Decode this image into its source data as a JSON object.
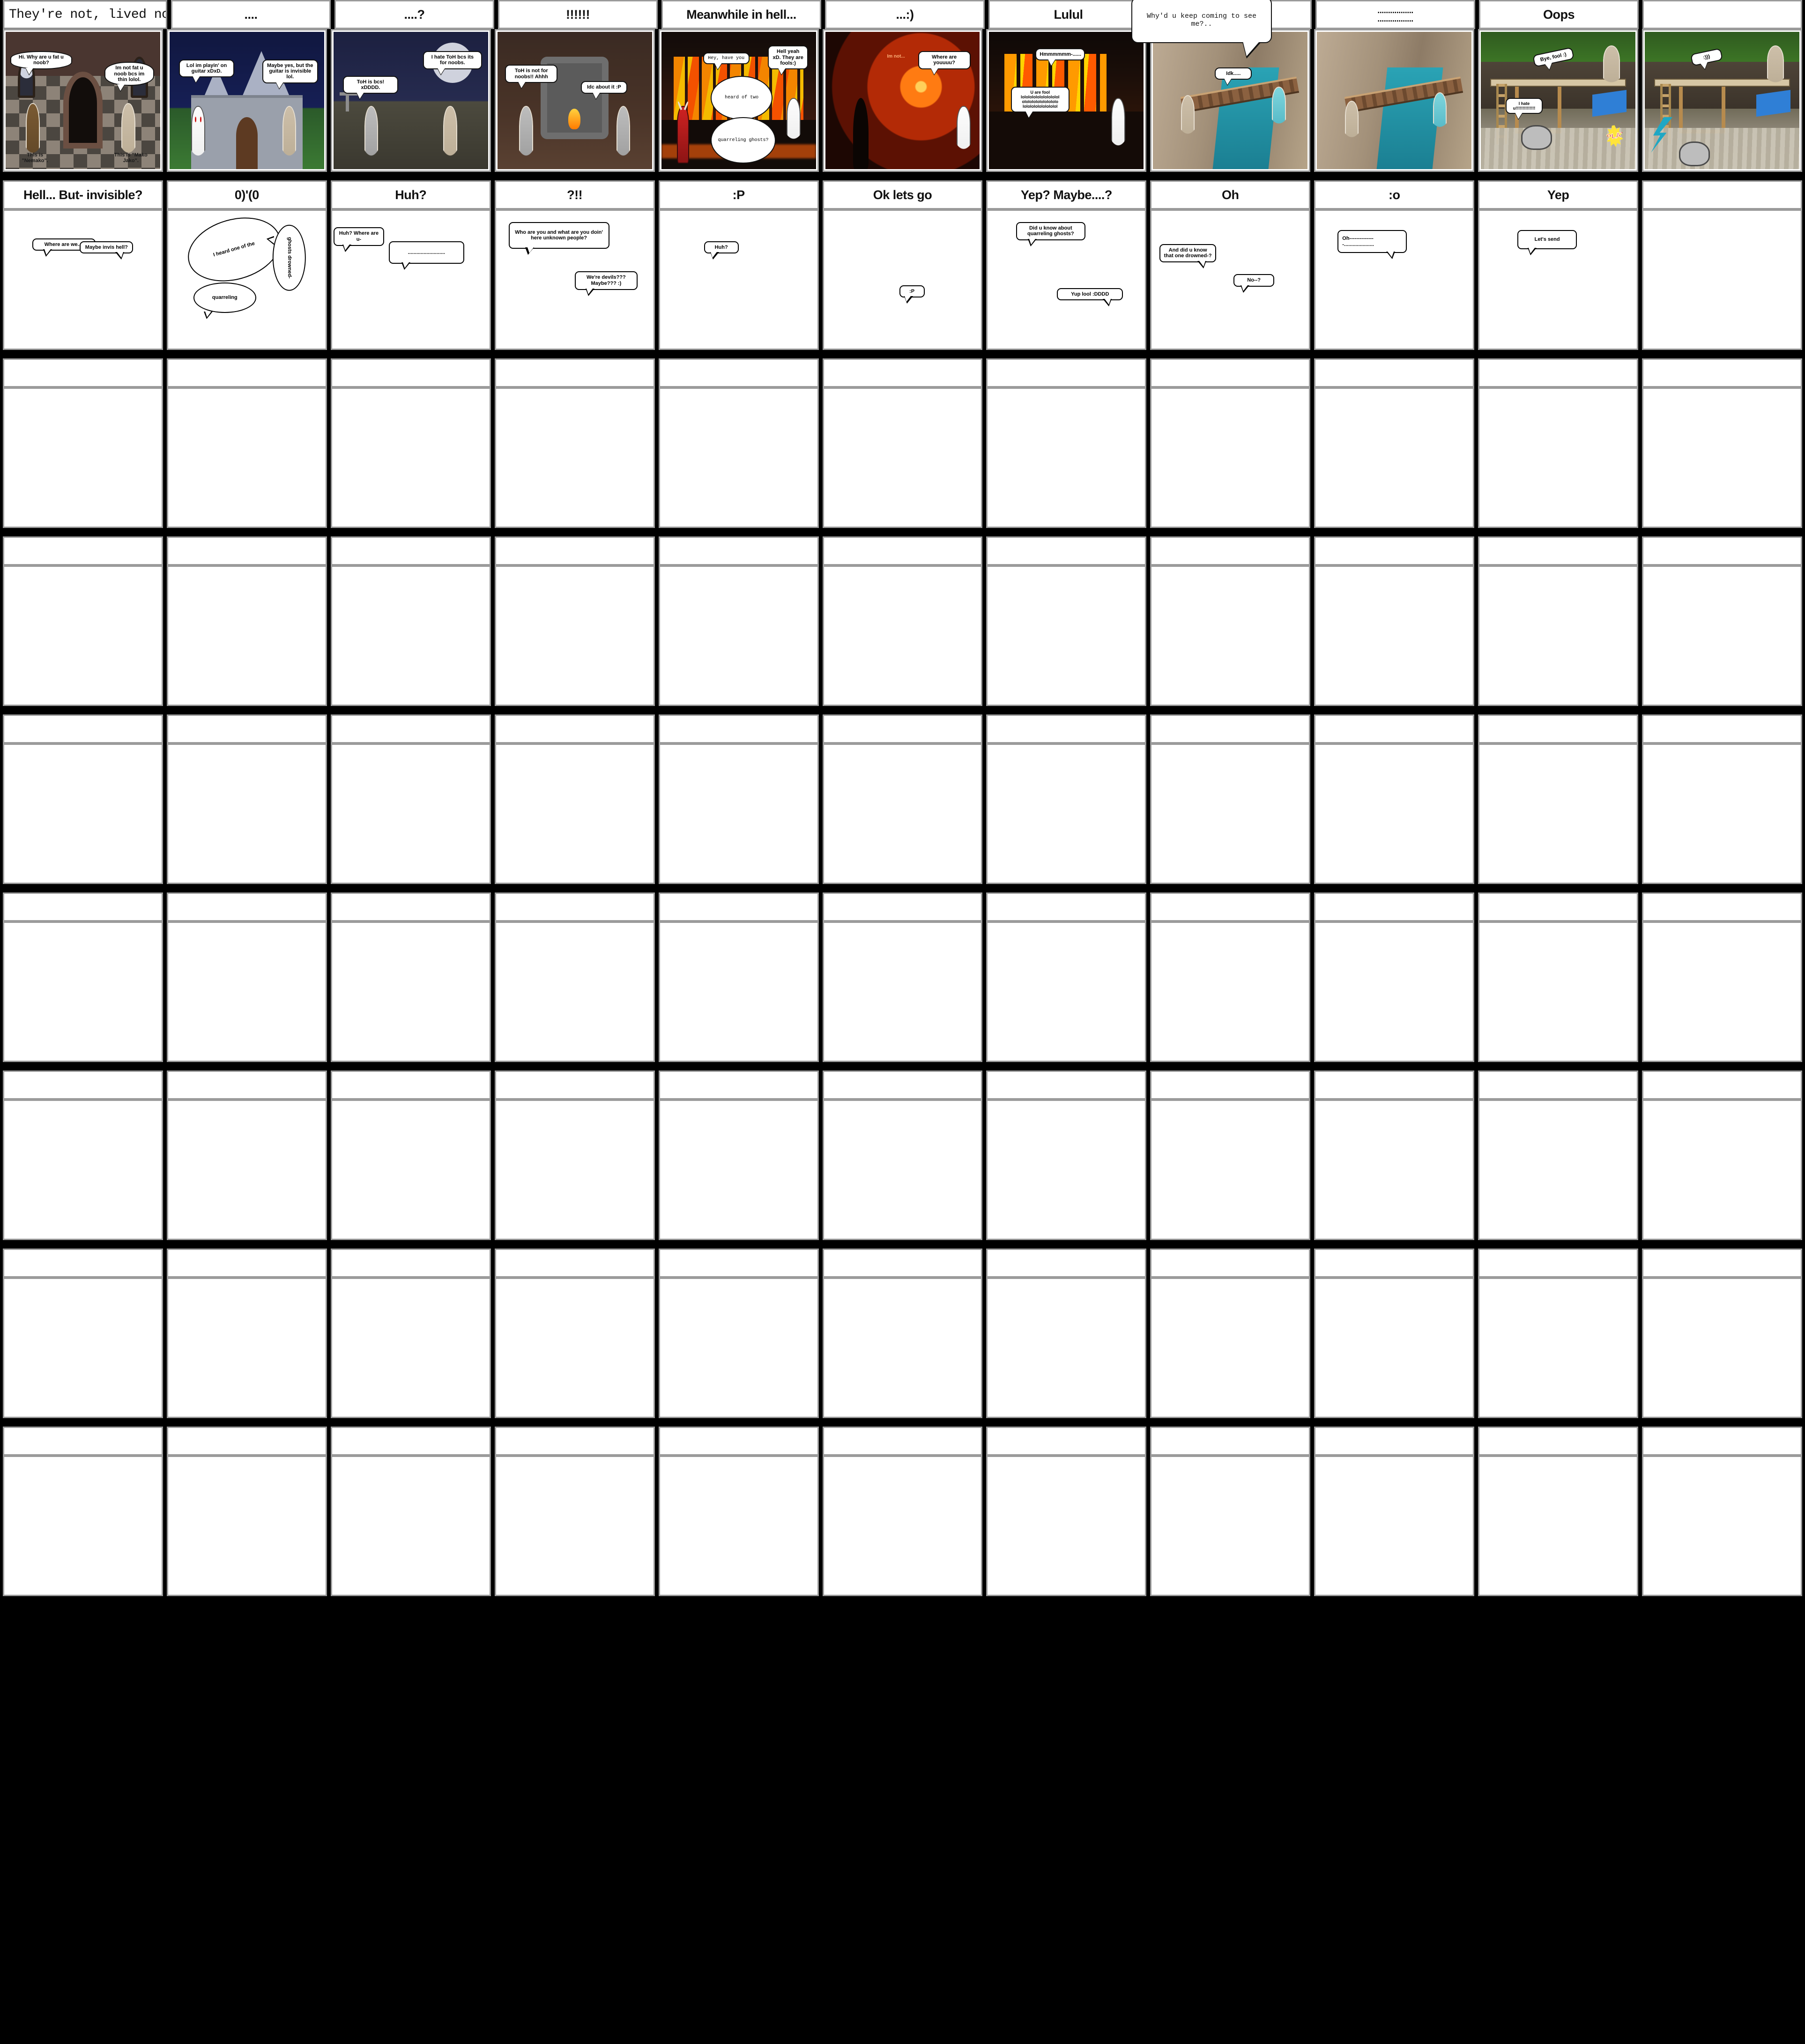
{
  "app": {
    "name": "storyboard-grid-editor",
    "columns": 11,
    "rows": 9,
    "background_color": "#000000",
    "cell_border_color": "#9b9b9b"
  },
  "overlay_textbox": {
    "text": "Why'd u keep coming to see me?..",
    "editable": true
  },
  "row1": {
    "titles": [
      {
        "text": "They're not, lived not li",
        "style": "input",
        "truncated": true
      },
      {
        "text": "....",
        "style": "title"
      },
      {
        "text": "....?",
        "style": "title"
      },
      {
        "text": "!!!!!!",
        "style": "title"
      },
      {
        "text": "Meanwhile in hell...",
        "style": "title"
      },
      {
        "text": "...:)",
        "style": "title"
      },
      {
        "text": "Lulul",
        "style": "title"
      },
      {
        "text": "",
        "style": "title"
      },
      {
        "text": ".................\n.................",
        "style": "title"
      },
      {
        "text": "Oops",
        "style": "title"
      },
      {
        "text": "",
        "style": "title"
      }
    ],
    "panels": [
      {
        "scene": "church-interior",
        "bubbles": [
          {
            "text": "Hi. Why are u fat u noob?",
            "shape": "cloud"
          },
          {
            "text": "Im not fat u noob bcs im thin lolol.",
            "shape": "cloud"
          },
          {
            "text": "This is \"Nemako\".",
            "shape": "caption"
          },
          {
            "text": "This is \"Mako Jako\".",
            "shape": "caption"
          }
        ]
      },
      {
        "scene": "castle-night",
        "bubbles": [
          {
            "text": "Lol im playin' on guitar xDxD.",
            "shape": "rect"
          },
          {
            "text": "Maybe yes, but the guitar is invisible lol.",
            "shape": "rect"
          }
        ]
      },
      {
        "scene": "graveyard-moon",
        "bubbles": [
          {
            "text": "ToH is bcs! xDDDD.",
            "shape": "rect"
          },
          {
            "text": "I hate ToH bcs its for noobs.",
            "shape": "rect"
          }
        ]
      },
      {
        "scene": "ruins-fire",
        "bubbles": [
          {
            "text": "ToH is not for noobs!! Ahhh",
            "shape": "rect"
          },
          {
            "text": "Idc about it :P",
            "shape": "rect"
          }
        ]
      },
      {
        "scene": "hell-flames",
        "bubbles": [
          {
            "text": "Hey, have you",
            "shape": "rect",
            "font": "mono"
          },
          {
            "text": "Hell yeah xD. They are fools:)",
            "shape": "rect"
          },
          {
            "text": "heard of two",
            "shape": "oval",
            "font": "mono"
          },
          {
            "text": "quarreling ghosts?",
            "shape": "oval",
            "font": "mono"
          }
        ]
      },
      {
        "scene": "hell-inferno",
        "bubbles": [
          {
            "text": "Im not...",
            "shape": "plain"
          },
          {
            "text": "Where are youuuu?",
            "shape": "rect"
          }
        ]
      },
      {
        "scene": "hell-cavern",
        "bubbles": [
          {
            "text": "Hmmmmmm-......",
            "shape": "rect"
          },
          {
            "text": "U are fool lolololololololololol olololololololololo lololololololololol",
            "shape": "rect"
          }
        ]
      },
      {
        "scene": "canyon-waterfall",
        "bubbles": [
          {
            "text": "Idk.....",
            "shape": "rect"
          }
        ]
      },
      {
        "scene": "canyon-waterfall",
        "bubbles": []
      },
      {
        "scene": "river-bridge",
        "bubbles": [
          {
            "text": "Bye, fool :)",
            "shape": "tilt"
          },
          {
            "text": "I hate u!!!!!!!!!!!!!!",
            "shape": "rect"
          },
          {
            "text": "SPLAT!",
            "shape": "burst"
          }
        ]
      },
      {
        "scene": "river-bridge",
        "bubbles": [
          {
            "text": ":)))",
            "shape": "tilt"
          }
        ]
      }
    ]
  },
  "row2": {
    "titles": [
      "Hell... But- invisible?",
      "0)'(0",
      "Huh?",
      "?!!",
      ":P",
      "Ok lets go",
      "Yep? Maybe....?",
      "Oh",
      ":o",
      "Yep",
      ""
    ],
    "panels": [
      {
        "bubbles": [
          {
            "text": "Where are we..?",
            "shape": "rect",
            "x": 18,
            "y": 20,
            "w": 40
          },
          {
            "text": "Maybe invis hell?",
            "shape": "rect",
            "x": 46,
            "y": 22,
            "w": 36
          }
        ]
      },
      {
        "bubbles": [
          {
            "text": "I heard one of the",
            "shape": "ellipse",
            "font": "mono",
            "rotate": -16,
            "x": 12,
            "y": 8,
            "w": 62
          },
          {
            "text": "ghosts drowned-",
            "shape": "ellipse",
            "font": "mono",
            "rotate": 90,
            "x": 64,
            "y": 22,
            "w": 46
          },
          {
            "text": "quarreling",
            "shape": "ellipse",
            "font": "mono",
            "x": 16,
            "y": 52,
            "w": 42
          }
        ]
      },
      {
        "bubbles": [
          {
            "text": "Huh? Where are u-",
            "shape": "rect",
            "x": 2,
            "y": 14,
            "w": 34
          },
          {
            "text": "..........................",
            "shape": "rect",
            "x": 36,
            "y": 22,
            "w": 48
          }
        ]
      },
      {
        "bubbles": [
          {
            "text": "Who are you and what are you doin' here unknown people?",
            "shape": "rect",
            "x": 10,
            "y": 10,
            "w": 62
          },
          {
            "text": "We're devils??? Maybe??? :)",
            "shape": "rect",
            "x": 52,
            "y": 42,
            "w": 38
          }
        ]
      },
      {
        "bubbles": [
          {
            "text": "Huh?",
            "shape": "rect",
            "x": 28,
            "y": 24,
            "w": 22
          }
        ]
      },
      {
        "bubbles": [
          {
            "text": ":P",
            "shape": "rect",
            "x": 48,
            "y": 54,
            "w": 18
          }
        ]
      },
      {
        "bubbles": [
          {
            "text": "Did u know about quarreling ghosts?",
            "shape": "rect",
            "x": 18,
            "y": 10,
            "w": 44
          },
          {
            "text": "Yup lool :DDDD",
            "shape": "rect",
            "x": 46,
            "y": 58,
            "w": 40
          }
        ]
      },
      {
        "bubbles": [
          {
            "text": "And did u know that one drowned-?",
            "shape": "rect",
            "x": 6,
            "y": 24,
            "w": 36
          },
          {
            "text": "No--?",
            "shape": "rect",
            "x": 54,
            "y": 46,
            "w": 26
          }
        ]
      },
      {
        "bubbles": [
          {
            "text": "Oh-------------- -.....................",
            "shape": "rect",
            "x": 14,
            "y": 16,
            "w": 44
          }
        ]
      },
      {
        "bubbles": [
          {
            "text": "Let's send",
            "shape": "rect",
            "x": 24,
            "y": 14,
            "w": 38
          }
        ]
      },
      {
        "bubbles": []
      }
    ]
  },
  "empty_rows": [
    {
      "index": 3,
      "titles": [
        "",
        "",
        "",
        "",
        "",
        "",
        "",
        "",
        "",
        "",
        ""
      ]
    },
    {
      "index": 4,
      "titles": [
        "",
        "",
        "",
        "",
        "",
        "",
        "",
        "",
        "",
        "",
        ""
      ]
    },
    {
      "index": 5,
      "titles": [
        "",
        "",
        "",
        "",
        "",
        "",
        "",
        "",
        "",
        "",
        ""
      ]
    },
    {
      "index": 6,
      "titles": [
        "",
        "",
        "",
        "",
        "",
        "",
        "",
        "",
        "",
        "",
        ""
      ]
    },
    {
      "index": 7,
      "titles": [
        "",
        "",
        "",
        "",
        "",
        "",
        "",
        "",
        "",
        "",
        ""
      ]
    },
    {
      "index": 8,
      "titles": [
        "",
        "",
        "",
        "",
        "",
        "",
        "",
        "",
        "",
        "",
        ""
      ]
    },
    {
      "index": 9,
      "titles": [
        "",
        "",
        "",
        "",
        "",
        "",
        "",
        "",
        "",
        "",
        ""
      ]
    }
  ]
}
